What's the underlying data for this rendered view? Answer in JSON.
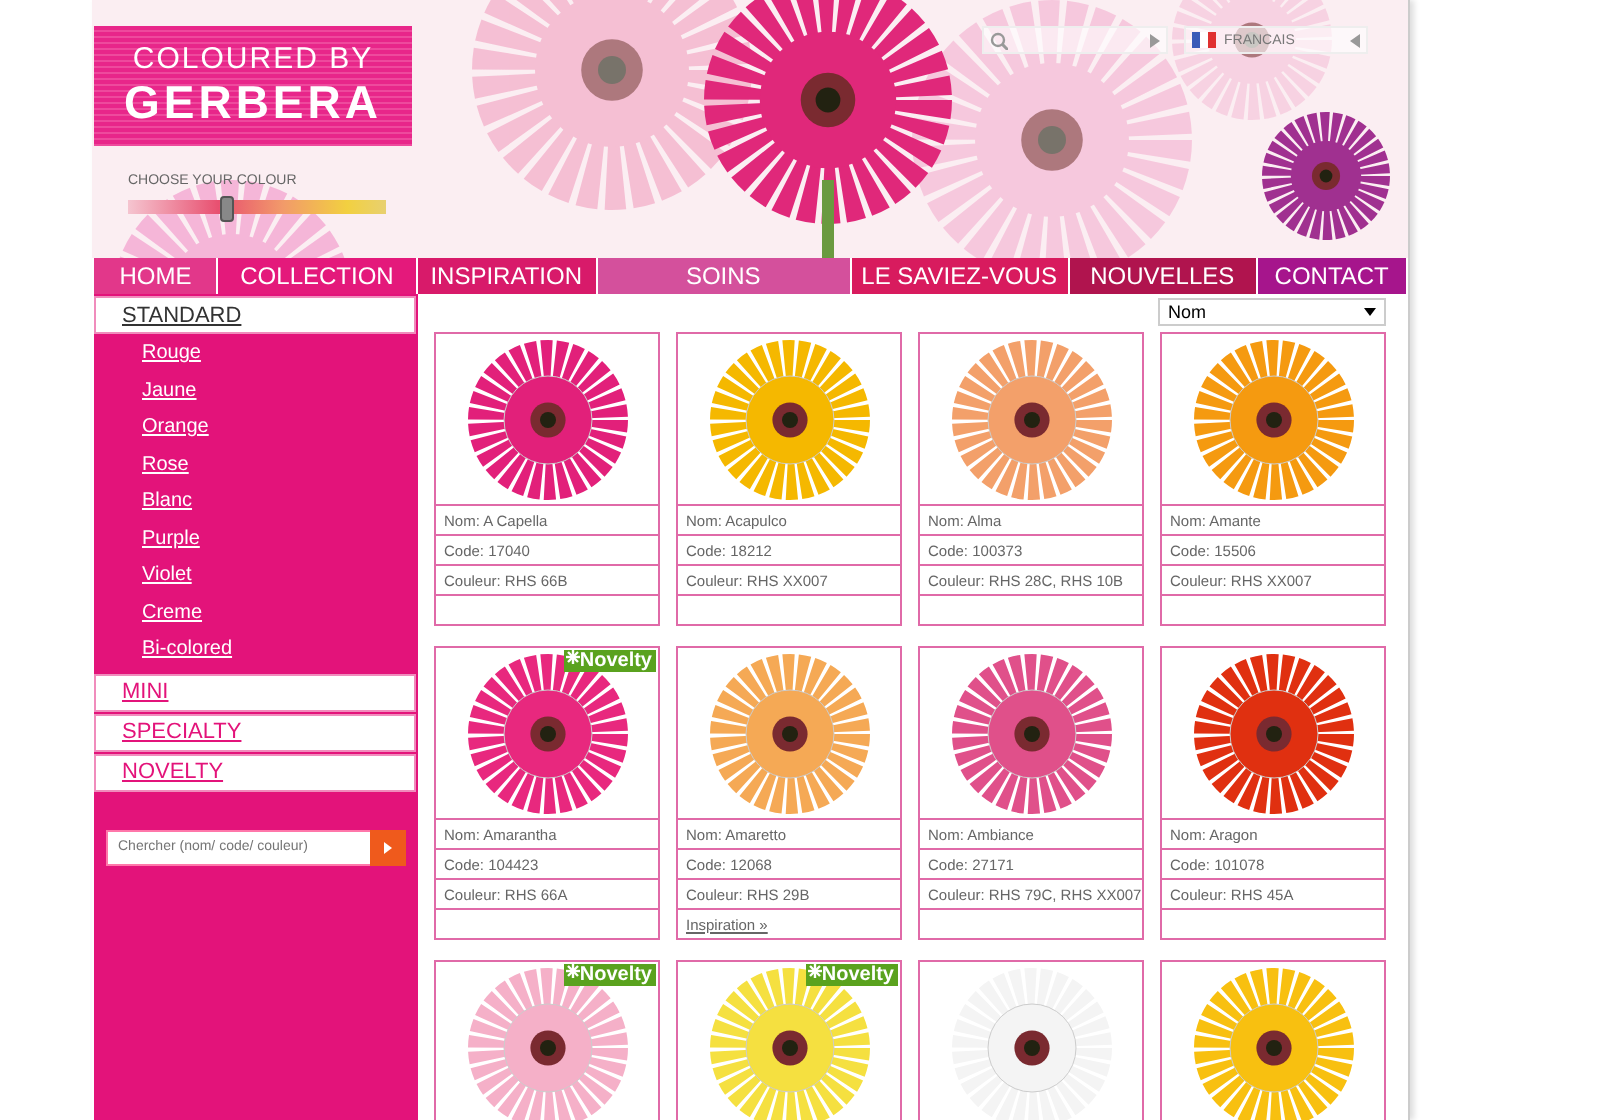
{
  "logo": {
    "line1": "COLOURED BY",
    "line2": "GERBERA"
  },
  "colour_picker": {
    "label": "CHOOSE YOUR COLOUR",
    "level": 0.38
  },
  "language": {
    "label": "FRANCAIS"
  },
  "nav": [
    {
      "label": "HOME",
      "color": "#e2378a"
    },
    {
      "label": "COLLECTION",
      "color": "#e4197b"
    },
    {
      "label": "INSPIRATION",
      "color": "#d81a6a"
    },
    {
      "label": "SOINS",
      "color": "#d4509c"
    },
    {
      "label": "LE SAVIEZ-VOUS",
      "color": "#d81b5e"
    },
    {
      "label": "NOUVELLES",
      "color": "#b0144e"
    },
    {
      "label": "CONTACT",
      "color": "#a6158c"
    }
  ],
  "sidebar": {
    "items": [
      {
        "label": "STANDARD",
        "selected": true,
        "children": [
          {
            "label": "Rouge"
          },
          {
            "label": "Jaune"
          },
          {
            "label": "Orange"
          },
          {
            "label": "Rose"
          },
          {
            "label": "Blanc"
          },
          {
            "label": "Purple"
          },
          {
            "label": "Violet"
          },
          {
            "label": "Creme"
          },
          {
            "label": "Bi-colored"
          }
        ]
      },
      {
        "label": "MINI",
        "selected": false
      },
      {
        "label": "SPECIALTY",
        "selected": false
      },
      {
        "label": "NOVELTY",
        "selected": false
      }
    ],
    "search": {
      "placeholder": "Chercher (nom/ code/ couleur)"
    }
  },
  "sort": {
    "value": "Nom"
  },
  "cards": [
    {
      "color": "#e2207a",
      "fields": [
        "Nom: A Capella",
        "Code: 17040",
        "Couleur: RHS 66B"
      ]
    },
    {
      "color": "#f5b800",
      "fields": [
        "Nom: Acapulco",
        "Code: 18212",
        "Couleur: RHS XX007"
      ]
    },
    {
      "color": "#f3a06a",
      "fields": [
        "Nom: Alma",
        "Code: 100373",
        "Couleur: RHS 28C, RHS 10B"
      ]
    },
    {
      "color": "#f59a10",
      "fields": [
        "Nom: Amante",
        "Code: 15506",
        "Couleur: RHS XX007"
      ]
    },
    {
      "color": "#e8287e",
      "badge": "Novelty",
      "fields": [
        "Nom: Amarantha",
        "Code: 104423",
        "Couleur: RHS 66A"
      ]
    },
    {
      "color": "#f5a955",
      "fields": [
        "Nom: Amaretto",
        "Code: 12068",
        "Couleur: RHS 29B"
      ],
      "link": "Inspiration »"
    },
    {
      "color": "#e0508a",
      "fields": [
        "Nom: Ambiance",
        "Code: 27171",
        "Couleur: RHS 79C, RHS XX007"
      ]
    },
    {
      "color": "#e03010",
      "fields": [
        "Nom: Aragon",
        "Code: 101078",
        "Couleur: RHS 45A"
      ]
    },
    {
      "color": "#f5b0c8",
      "badge": "Novelty"
    },
    {
      "color": "#f5e040",
      "badge": "Novelty"
    },
    {
      "color": "#f4f4f4"
    },
    {
      "color": "#f8c010"
    }
  ]
}
